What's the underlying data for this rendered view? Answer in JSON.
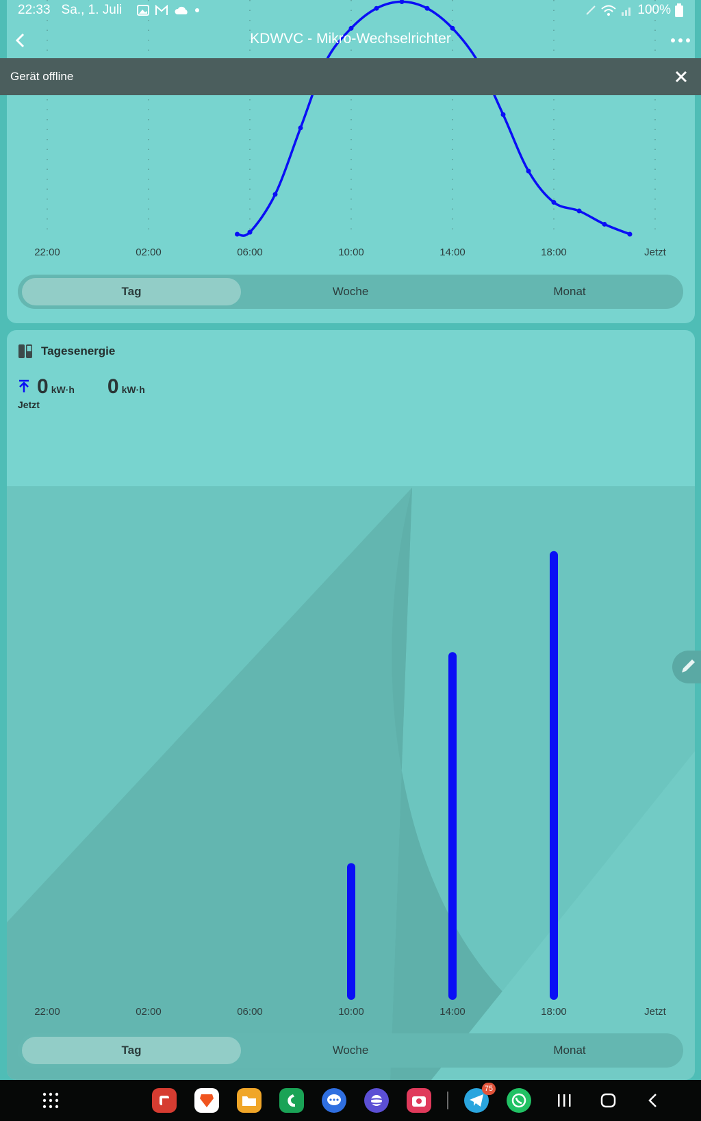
{
  "status_bar": {
    "time": "22:33",
    "date": "Sa., 1. Juli",
    "battery": "100%",
    "icons": [
      "gallery-icon",
      "gmail-icon",
      "cloud-icon",
      "dot-icon",
      "pen-icon",
      "wifi-icon",
      "signal-icon",
      "battery-icon"
    ]
  },
  "app_bar": {
    "title": "KDWVC - Mikro-Wechselrichter",
    "back_icon": "back-arrow-icon",
    "menu_icon": "more-dots-icon"
  },
  "offline_banner": {
    "text": "Gerät offline",
    "close_icon": "close-icon"
  },
  "power_chart": {
    "x_labels": [
      "22:00",
      "02:00",
      "06:00",
      "10:00",
      "14:00",
      "18:00",
      "Jetzt"
    ],
    "series_color": "#0a0ff5",
    "tabs": [
      "Tag",
      "Woche",
      "Monat"
    ],
    "active_tab": "Tag"
  },
  "energy_card": {
    "icon": "energy-card-icon",
    "title": "Tagesenergie",
    "values": [
      {
        "value": "0",
        "unit": "kW·h",
        "icon": "upload-arrow-icon",
        "label": "Jetzt"
      },
      {
        "value": "0",
        "unit": "kW·h"
      }
    ],
    "tabs": [
      "Tag",
      "Woche",
      "Monat"
    ],
    "active_tab": "Tag",
    "edit_icon": "pencil-icon"
  },
  "chart_data": [
    {
      "type": "line",
      "x": [
        "05:30",
        "06:00",
        "07:00",
        "08:00",
        "09:00",
        "10:00",
        "11:00",
        "12:00",
        "13:00",
        "14:00",
        "15:00",
        "16:00",
        "17:00",
        "18:00",
        "19:00",
        "20:00",
        "21:00"
      ],
      "y": [
        0.0,
        0.03,
        0.6,
        1.6,
        2.6,
        3.1,
        3.4,
        3.5,
        3.4,
        3.1,
        2.6,
        1.8,
        0.95,
        0.48,
        0.35,
        0.15,
        0.0
      ],
      "x_tick_labels": [
        "22:00",
        "02:00",
        "06:00",
        "10:00",
        "14:00",
        "18:00",
        "Jetzt"
      ],
      "grid": "vertical dotted",
      "legend": "none",
      "color": "#0a0ff5"
    },
    {
      "type": "bar",
      "categories": [
        "22:00",
        "02:00",
        "06:00",
        "10:00",
        "14:00",
        "18:00",
        "Jetzt"
      ],
      "values": [
        0,
        0,
        0,
        28,
        74,
        96,
        0
      ],
      "color": "#0a0ff5",
      "legend": "none"
    }
  ],
  "nav_bar": {
    "apps": [
      {
        "name": "app-drawer-icon",
        "color": "#060807"
      },
      {
        "name": "notes-app-icon",
        "color": "#d63c31"
      },
      {
        "name": "brave-browser-icon",
        "color": "#ffffff"
      },
      {
        "name": "files-app-icon",
        "color": "#f0a628"
      },
      {
        "name": "phone-app-icon",
        "color": "#1aa356"
      },
      {
        "name": "messages-app-icon",
        "color": "#2f6fe0"
      },
      {
        "name": "internet-app-icon",
        "color": "#5b4fd4"
      },
      {
        "name": "camera-app-icon",
        "color": "#e03a5b"
      },
      {
        "name": "telegram-app-icon",
        "color": "#2aa5de",
        "badge": "75"
      },
      {
        "name": "whatsapp-app-icon",
        "color": "#21c164"
      }
    ],
    "system": [
      "recent-apps-icon",
      "home-icon",
      "back-icon"
    ]
  }
}
